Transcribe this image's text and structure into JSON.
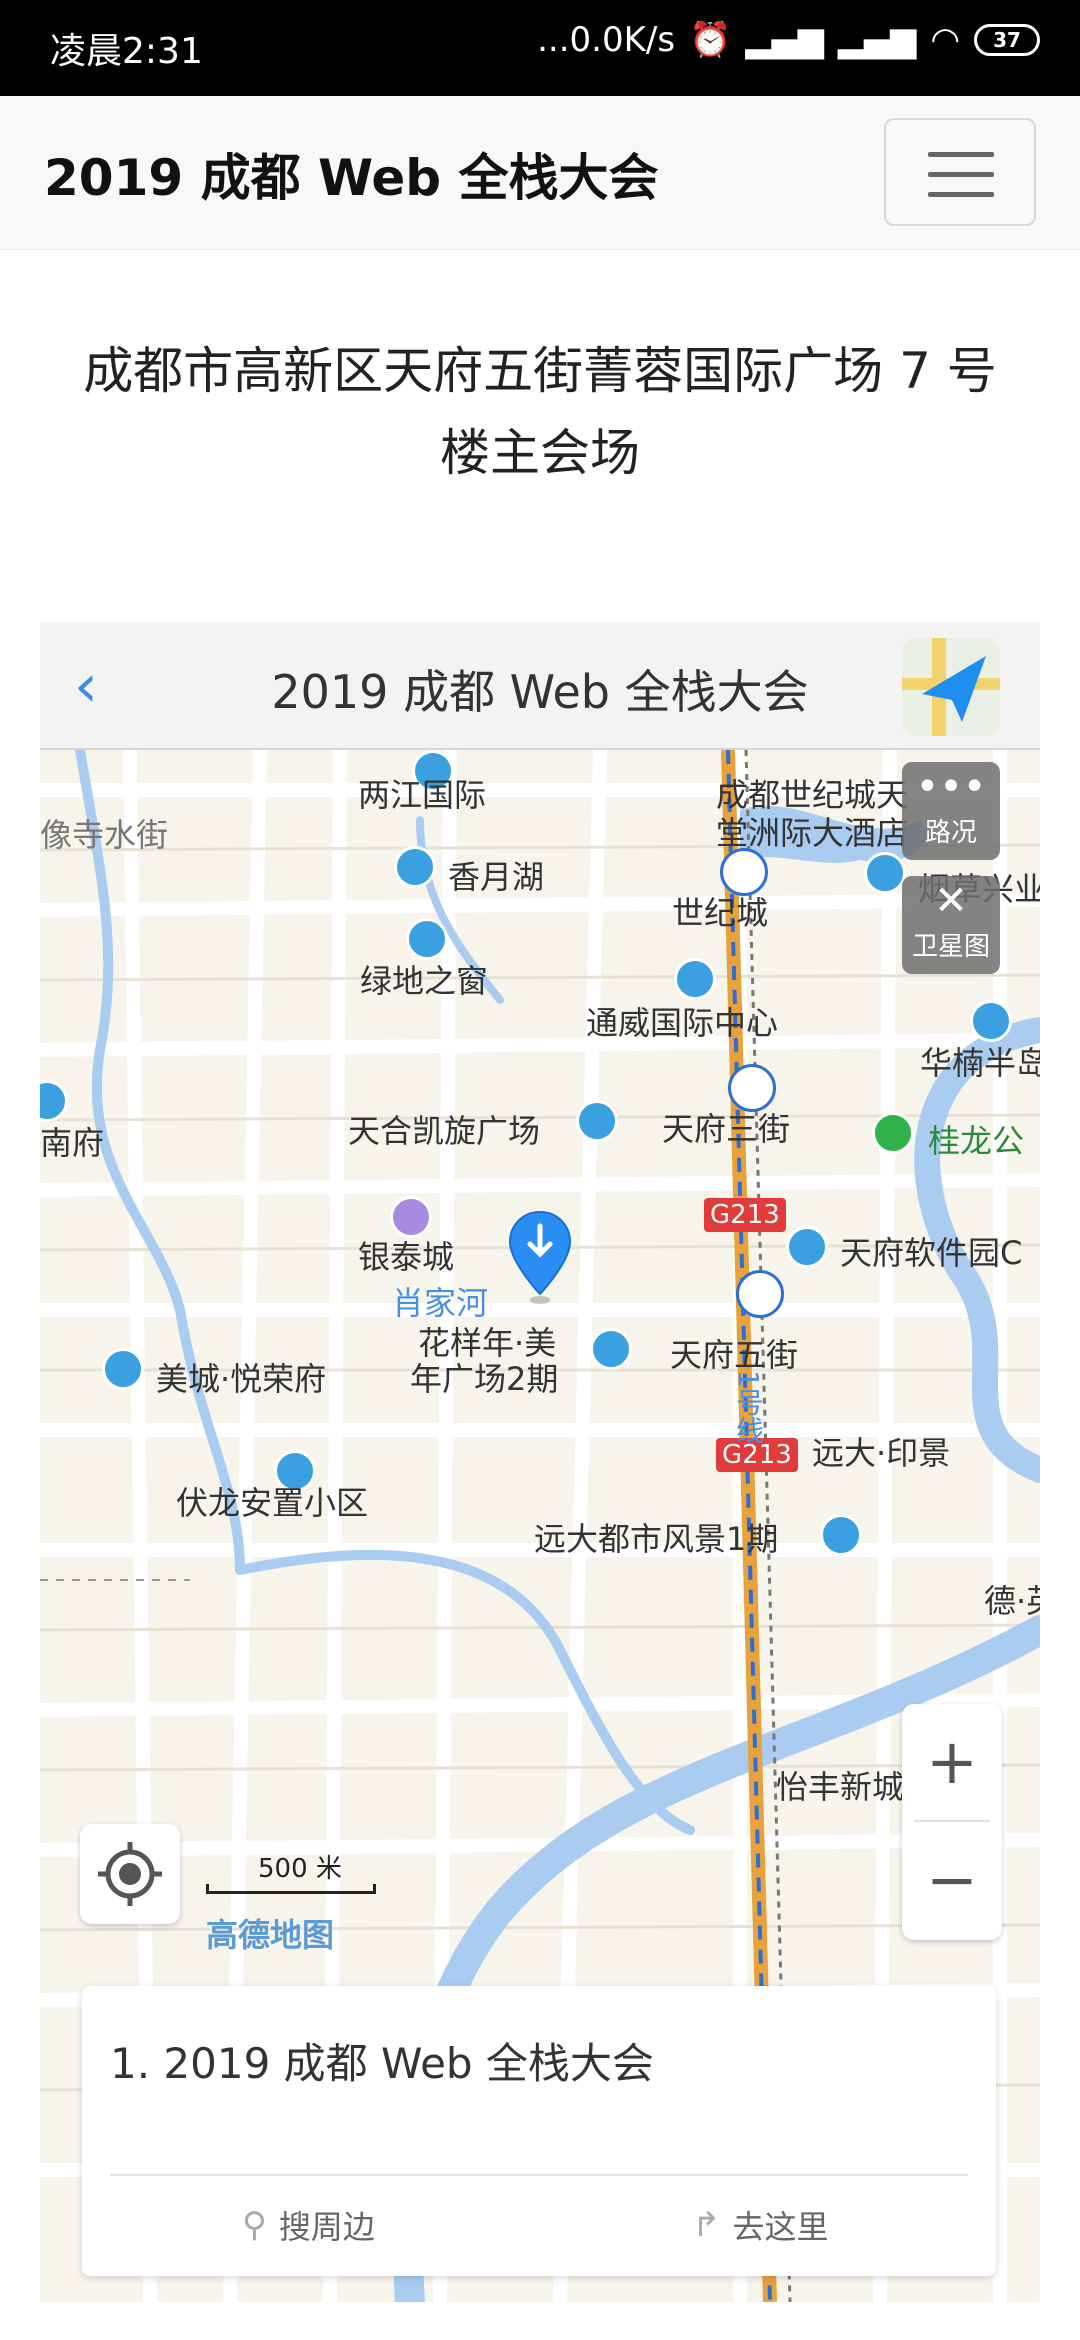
{
  "statusbar": {
    "time": "凌晨2:31",
    "network_speed": "...0.0K/s",
    "battery": "37",
    "icons": [
      "alarm-icon",
      "signal-icon",
      "hd-signal-icon",
      "wifi-icon",
      "battery-icon"
    ]
  },
  "navbar": {
    "brand": "2019 成都 Web 全栈大会",
    "menu_icon": "hamburger-icon"
  },
  "address": {
    "line1": "成都市高新区天府五街菁蓉国际广场 7 号",
    "line2": "楼主会场"
  },
  "map": {
    "header_title": "2019 成都 Web 全栈大会",
    "back_icon": "chevron-left-icon",
    "nav_app_icon": "navigation-app-icon",
    "labels": [
      {
        "text": "两江国际",
        "kind": "poi"
      },
      {
        "text": "像寺水街",
        "kind": "road"
      },
      {
        "text": "香月湖",
        "kind": "poi"
      },
      {
        "text": "成都世纪城天",
        "kind": "poi"
      },
      {
        "text": "堂洲际大酒店",
        "kind": "poi"
      },
      {
        "text": "世纪城",
        "kind": "metro"
      },
      {
        "text": "烟草兴业",
        "kind": "poi"
      },
      {
        "text": "绿地之窗",
        "kind": "poi"
      },
      {
        "text": "通威国际中心",
        "kind": "poi"
      },
      {
        "text": "华楠半岛",
        "kind": "poi"
      },
      {
        "text": "南府",
        "kind": "poi"
      },
      {
        "text": "天合凯旋广场",
        "kind": "poi"
      },
      {
        "text": "天府三街",
        "kind": "metro"
      },
      {
        "text": "桂龙公",
        "kind": "park"
      },
      {
        "text": "银泰城",
        "kind": "poi"
      },
      {
        "text": "天府软件园C",
        "kind": "poi"
      },
      {
        "text": "肖家河",
        "kind": "water"
      },
      {
        "text": "花样年·美",
        "kind": "poi"
      },
      {
        "text": "年广场2期",
        "kind": "poi"
      },
      {
        "text": "天府五街",
        "kind": "metro"
      },
      {
        "text": "美城·悦荣府",
        "kind": "poi"
      },
      {
        "text": "1号线",
        "kind": "metro-line"
      },
      {
        "text": "远大·印景",
        "kind": "poi"
      },
      {
        "text": "伏龙安置小区",
        "kind": "poi"
      },
      {
        "text": "远大都市风景1期",
        "kind": "poi"
      },
      {
        "text": "德·英",
        "kind": "poi"
      },
      {
        "text": "怡丰新城",
        "kind": "poi"
      }
    ],
    "road_badges": [
      "G213",
      "G213"
    ],
    "controls": {
      "traffic_label": "路况",
      "satellite_label": "卫星图",
      "zoom_in": "+",
      "zoom_out": "−"
    },
    "scale_label": "500 米",
    "attribution": "高德地图"
  },
  "card": {
    "title": "1. 2019 成都 Web 全栈大会",
    "nearby_label": "搜周边",
    "goto_label": "去这里"
  },
  "colors": {
    "water": "#a9ccf0",
    "road": "#ffffff",
    "metro_line": "#e9a13b",
    "accent": "#3a8ee6",
    "map_bg": "#f7f4ec"
  }
}
